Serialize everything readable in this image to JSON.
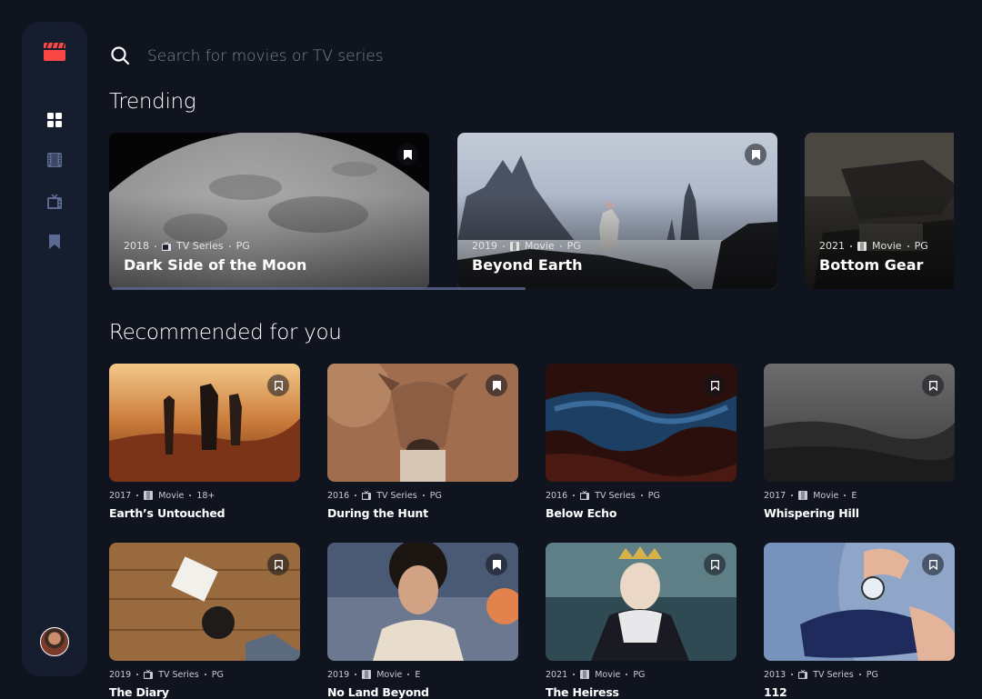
{
  "search": {
    "placeholder": "Search for movies or TV series"
  },
  "sections": {
    "trending": "Trending",
    "recommended": "Recommended for you"
  },
  "sidebar": {
    "items": [
      {
        "name": "home",
        "icon": "grid-icon",
        "active": true
      },
      {
        "name": "movies",
        "icon": "film-icon",
        "active": false
      },
      {
        "name": "tv-series",
        "icon": "tv-icon",
        "active": false
      },
      {
        "name": "bookmarks",
        "icon": "bookmark-icon",
        "active": false
      }
    ]
  },
  "colors": {
    "accent": "#FC4747",
    "background": "#10141E",
    "surface": "#161D2F",
    "muted": "#5A698F"
  },
  "trending": [
    {
      "year": "2018",
      "category": "TV Series",
      "rating": "PG",
      "title": "Dark Side of the Moon"
    },
    {
      "year": "2019",
      "category": "Movie",
      "rating": "PG",
      "title": "Beyond Earth"
    },
    {
      "year": "2021",
      "category": "Movie",
      "rating": "PG",
      "title": "Bottom Gear"
    }
  ],
  "recommended": [
    {
      "year": "2017",
      "category": "Movie",
      "rating": "18+",
      "title": "Earth’s Untouched"
    },
    {
      "year": "2016",
      "category": "TV Series",
      "rating": "PG",
      "title": "During the Hunt"
    },
    {
      "year": "2016",
      "category": "TV Series",
      "rating": "PG",
      "title": "Below Echo"
    },
    {
      "year": "2017",
      "category": "Movie",
      "rating": "E",
      "title": "Whispering Hill"
    },
    {
      "year": "2019",
      "category": "TV Series",
      "rating": "PG",
      "title": "The Diary"
    },
    {
      "year": "2019",
      "category": "Movie",
      "rating": "E",
      "title": "No Land Beyond"
    },
    {
      "year": "2021",
      "category": "Movie",
      "rating": "PG",
      "title": "The Heiress"
    },
    {
      "year": "2013",
      "category": "TV Series",
      "rating": "PG",
      "title": "112"
    }
  ]
}
